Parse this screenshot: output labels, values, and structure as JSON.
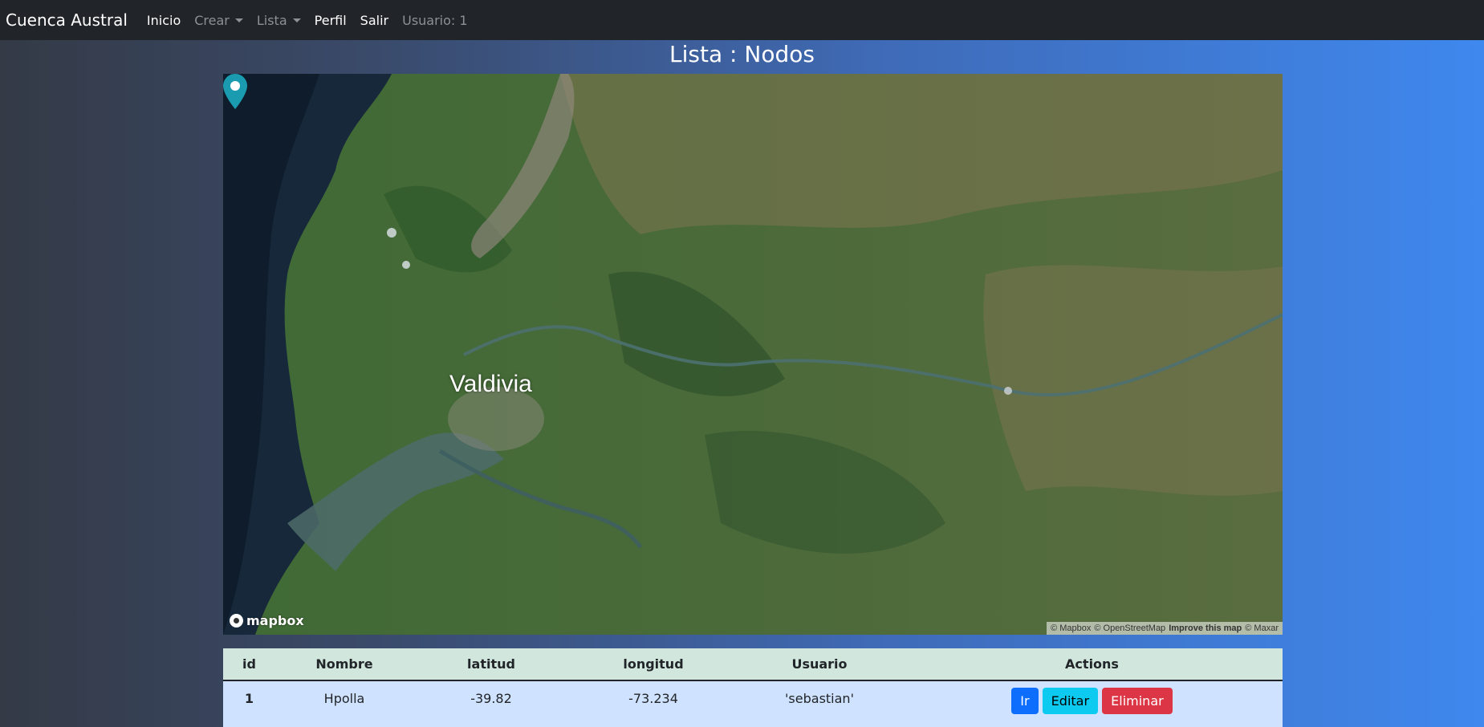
{
  "navbar": {
    "brand": "Cuenca Austral",
    "items": [
      {
        "label": "Inicio"
      },
      {
        "label": "Crear"
      },
      {
        "label": "Lista"
      },
      {
        "label": "Perfil"
      },
      {
        "label": "Salir"
      }
    ],
    "user": "Usuario: 1"
  },
  "page": {
    "title": "Lista : Nodos"
  },
  "map": {
    "style": "satellite",
    "place_label": "Valdivia",
    "marker": {
      "lat": -39.82,
      "lng": -73.234,
      "color": "#1a9bb0"
    },
    "logo": "mapbox",
    "attribution": {
      "mapbox": "© Mapbox",
      "osm": "© OpenStreetMap",
      "improve": "Improve this map",
      "maxar": "© Maxar"
    }
  },
  "table": {
    "headers": [
      "id",
      "Nombre",
      "latitud",
      "longitud",
      "Usuario",
      "Actions"
    ],
    "rows": [
      {
        "id": "1",
        "nombre": "Hpolla",
        "latitud": "-39.82",
        "longitud": "-73.234",
        "usuario": "'sebastian'"
      }
    ],
    "actions": {
      "go": "Ir",
      "edit": "Editar",
      "delete": "Eliminar"
    }
  },
  "colors": {
    "navbar_bg": "#212529",
    "header_row": "#d1e7dd",
    "body_row": "#cfe2ff",
    "btn_primary": "#0d6efd",
    "btn_info": "#0dcaf0",
    "btn_danger": "#dc3545"
  }
}
